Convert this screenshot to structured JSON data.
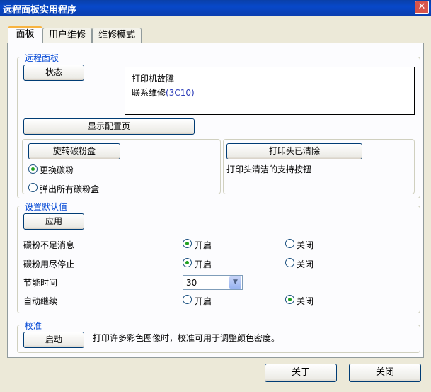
{
  "window": {
    "title": "远程面板实用程序",
    "close_glyph": "✕"
  },
  "tabs": [
    "面板",
    "用户维修",
    "维修模式"
  ],
  "remote_panel": {
    "legend": "远程面板",
    "status_button": "状态",
    "status_lines": [
      "打印机故障",
      "联系维修"
    ],
    "status_code": "(3C10)",
    "config_page_button": "显示配置页",
    "rotate_button": "旋转碳粉盒",
    "radio_replace": "更换碳粉",
    "radio_eject": "弹出所有碳粉盒",
    "clean_button": "打印头已清除",
    "clean_desc": "打印头清洁的支持按钮"
  },
  "defaults": {
    "legend": "设置默认值",
    "apply_button": "应用",
    "rows": [
      {
        "label": "碳粉不足消息",
        "on": "开启",
        "off": "关闭",
        "selected": "on"
      },
      {
        "label": "碳粉用尽停止",
        "on": "开启",
        "off": "关闭",
        "selected": "on"
      }
    ],
    "powersave_label": "节能时间",
    "powersave_value": "30",
    "autocontinue": {
      "label": "自动继续",
      "on": "开启",
      "off": "关闭",
      "selected": "off"
    }
  },
  "calibration": {
    "legend": "校准",
    "start_button": "启动",
    "desc": "打印许多彩色图像时，校准可用于调整颜色密度。"
  },
  "footer": {
    "about_button": "关于",
    "close_button": "关闭"
  }
}
